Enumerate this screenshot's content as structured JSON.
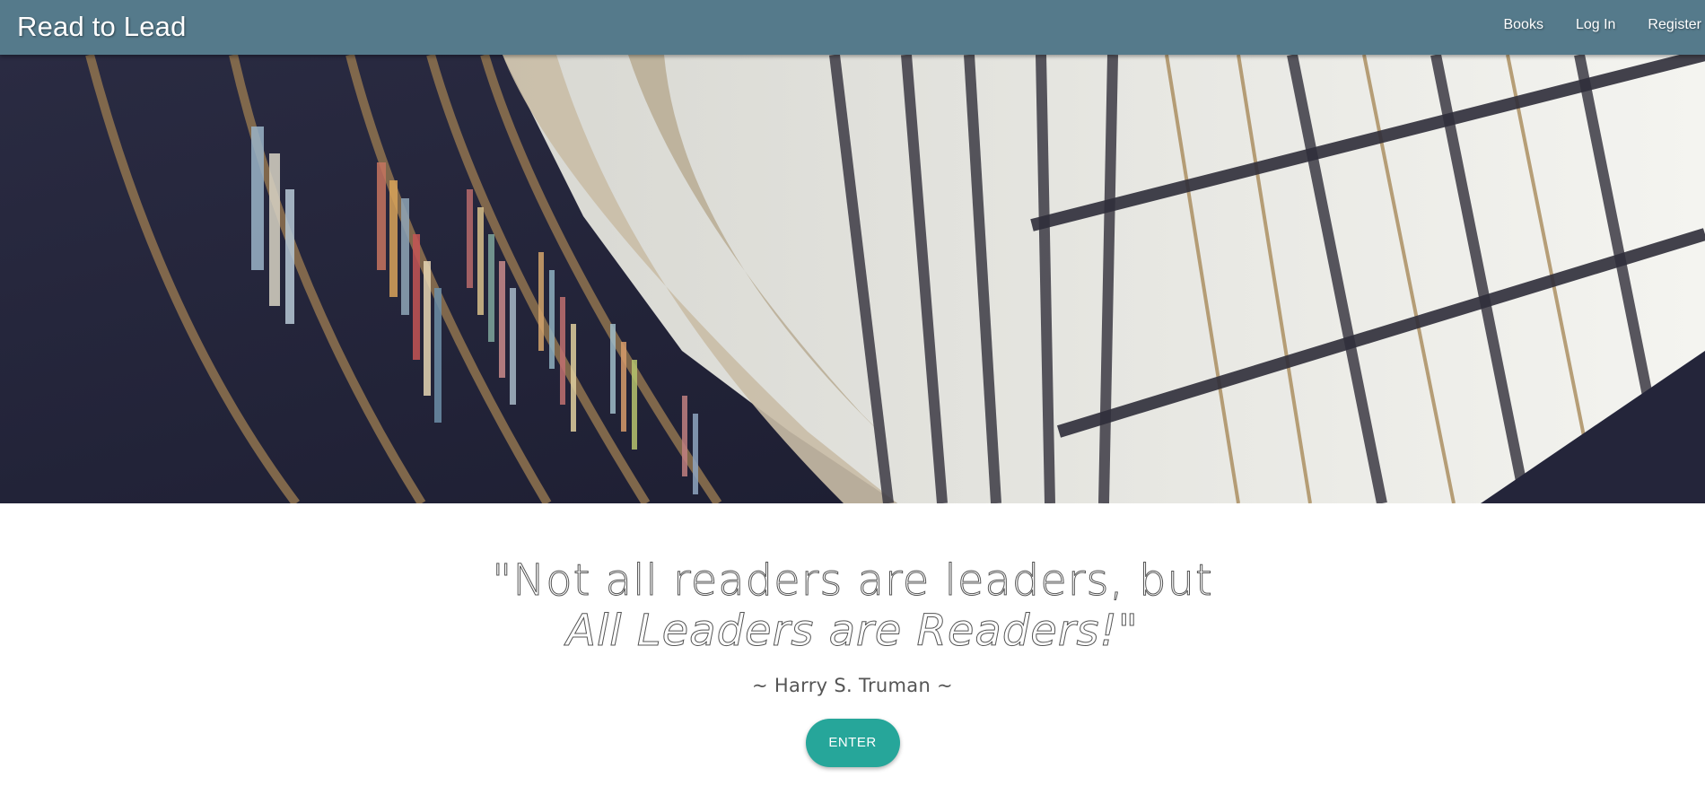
{
  "navbar": {
    "brand": "Read to Lead",
    "links": [
      {
        "label": "Books"
      },
      {
        "label": "Log In"
      },
      {
        "label": "Register"
      }
    ],
    "background_color": "#557a8b"
  },
  "hero": {
    "image": "library-bookshelves-with-skylight"
  },
  "quote": {
    "line1": "\"Not all readers are leaders, but",
    "line2": "All Leaders are Readers!\"",
    "author": "~ Harry S. Truman ~"
  },
  "cta": {
    "label": "ENTER",
    "color": "#26a69a"
  }
}
